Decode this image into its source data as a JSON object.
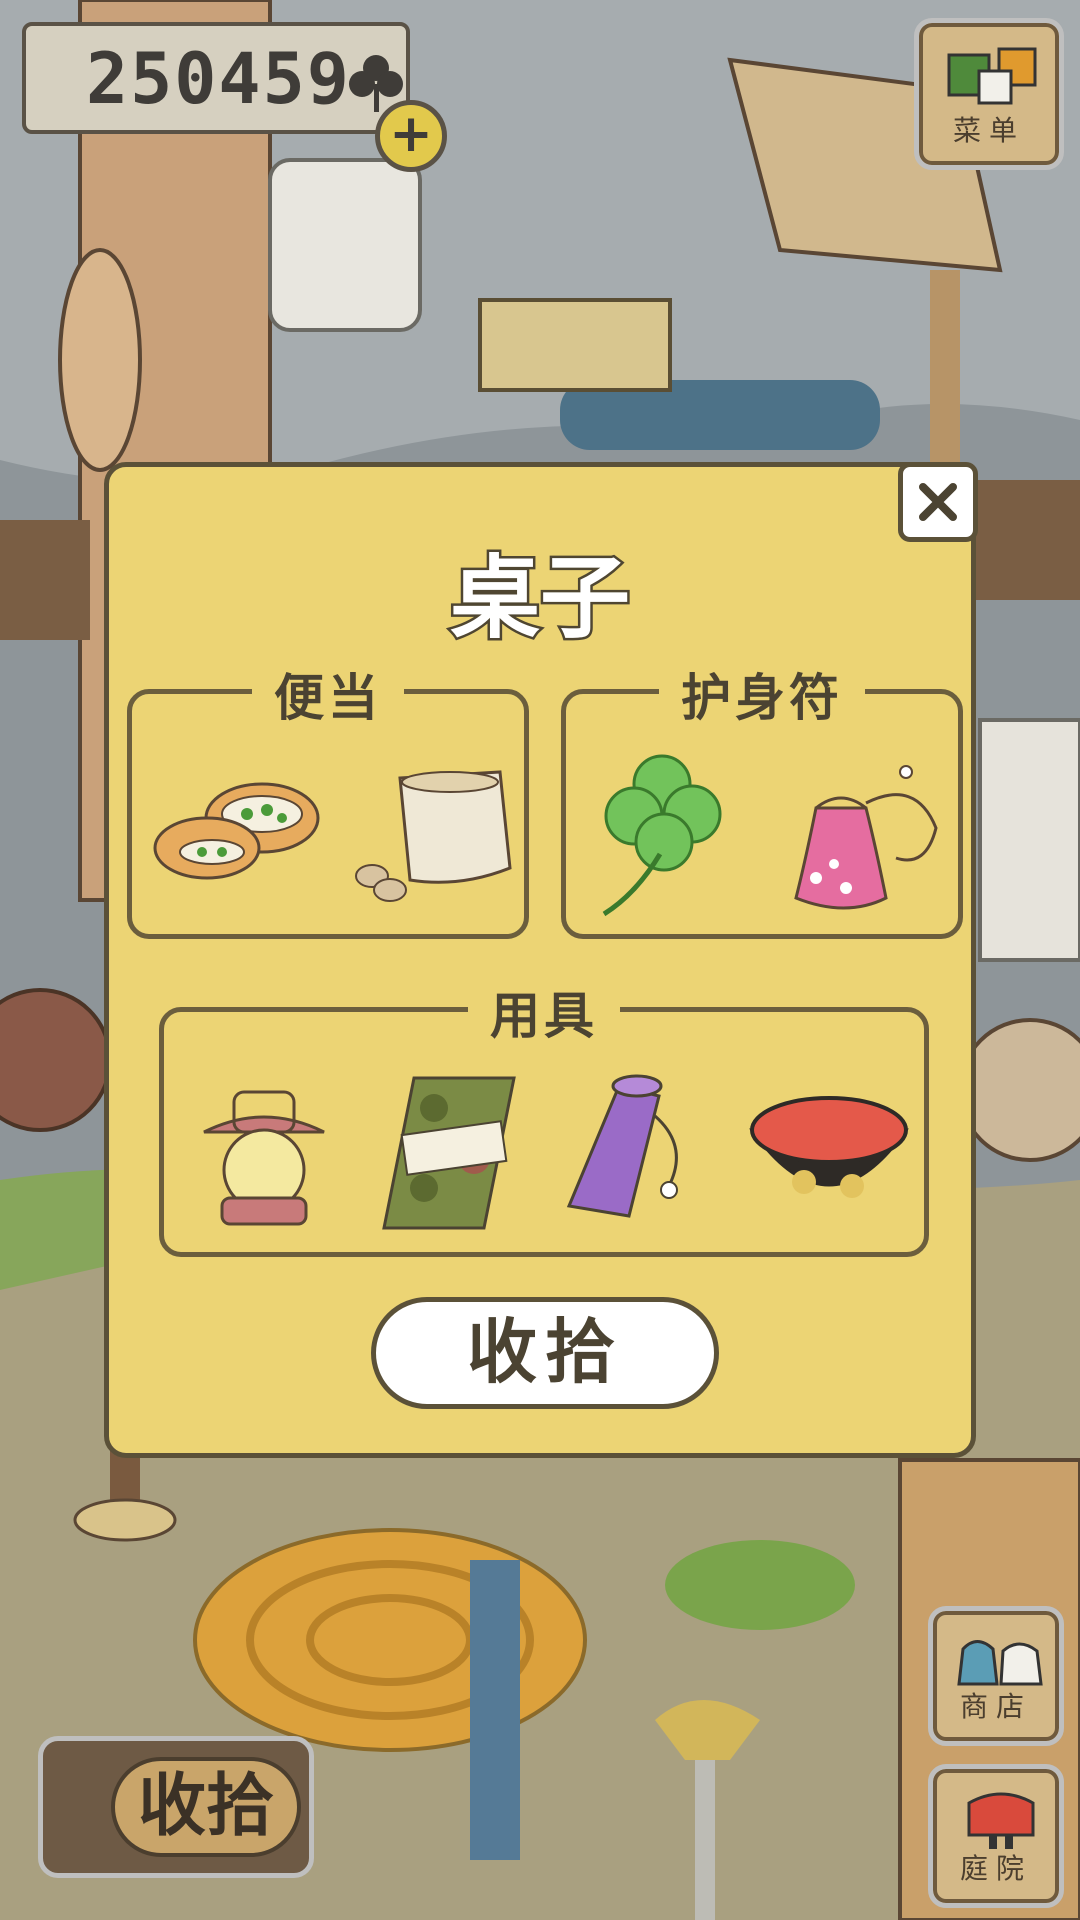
{
  "hud": {
    "clover_count": "250459",
    "menu_label": "菜单",
    "shop_label": "商店",
    "garden_label": "庭院",
    "collect_label": "收拾"
  },
  "modal": {
    "title": "桌子",
    "groups": [
      {
        "label": "便当",
        "items": [
          "sandwich-bread",
          "bag-of-nuts"
        ]
      },
      {
        "label": "护身符",
        "items": [
          "four-leaf-clover",
          "pink-pouch-charm"
        ]
      },
      {
        "label": "用具",
        "items": [
          "lantern",
          "camo-tenugui",
          "purple-bottle-bag",
          "red-bowl"
        ]
      }
    ],
    "collect_button": "收拾"
  },
  "colors": {
    "modal_bg": "#ecd474",
    "outline": "#5b5138",
    "button_bg": "#ffffff"
  }
}
